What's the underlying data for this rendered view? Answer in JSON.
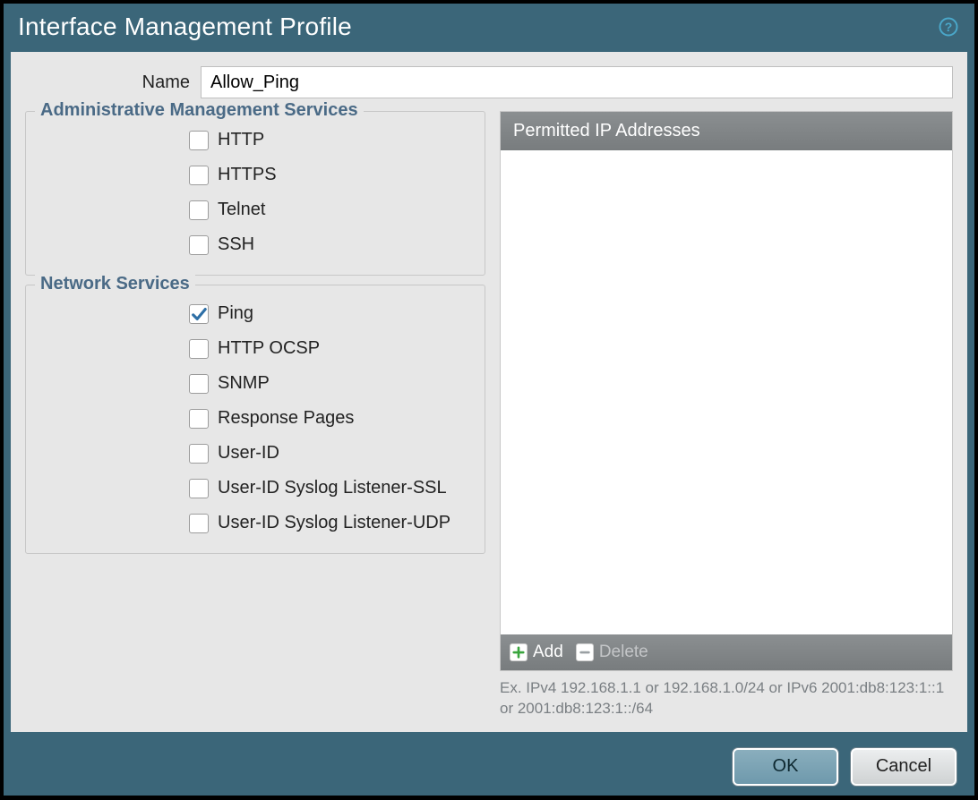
{
  "dialog": {
    "title": "Interface Management Profile",
    "name_label": "Name",
    "name_value": "Allow_Ping"
  },
  "adminSection": {
    "legend": "Administrative Management Services",
    "items": [
      {
        "label": "HTTP",
        "checked": false
      },
      {
        "label": "HTTPS",
        "checked": false
      },
      {
        "label": "Telnet",
        "checked": false
      },
      {
        "label": "SSH",
        "checked": false
      }
    ]
  },
  "networkSection": {
    "legend": "Network Services",
    "items": [
      {
        "label": "Ping",
        "checked": true
      },
      {
        "label": "HTTP OCSP",
        "checked": false
      },
      {
        "label": "SNMP",
        "checked": false
      },
      {
        "label": "Response Pages",
        "checked": false
      },
      {
        "label": "User-ID",
        "checked": false
      },
      {
        "label": "User-ID Syslog Listener-SSL",
        "checked": false
      },
      {
        "label": "User-ID Syslog Listener-UDP",
        "checked": false
      }
    ]
  },
  "ipPanel": {
    "header": "Permitted IP Addresses",
    "add_label": "Add",
    "delete_label": "Delete",
    "hint": "Ex. IPv4 192.168.1.1 or 192.168.1.0/24 or IPv6 2001:db8:123:1::1 or 2001:db8:123:1::/64"
  },
  "buttons": {
    "ok": "OK",
    "cancel": "Cancel"
  }
}
